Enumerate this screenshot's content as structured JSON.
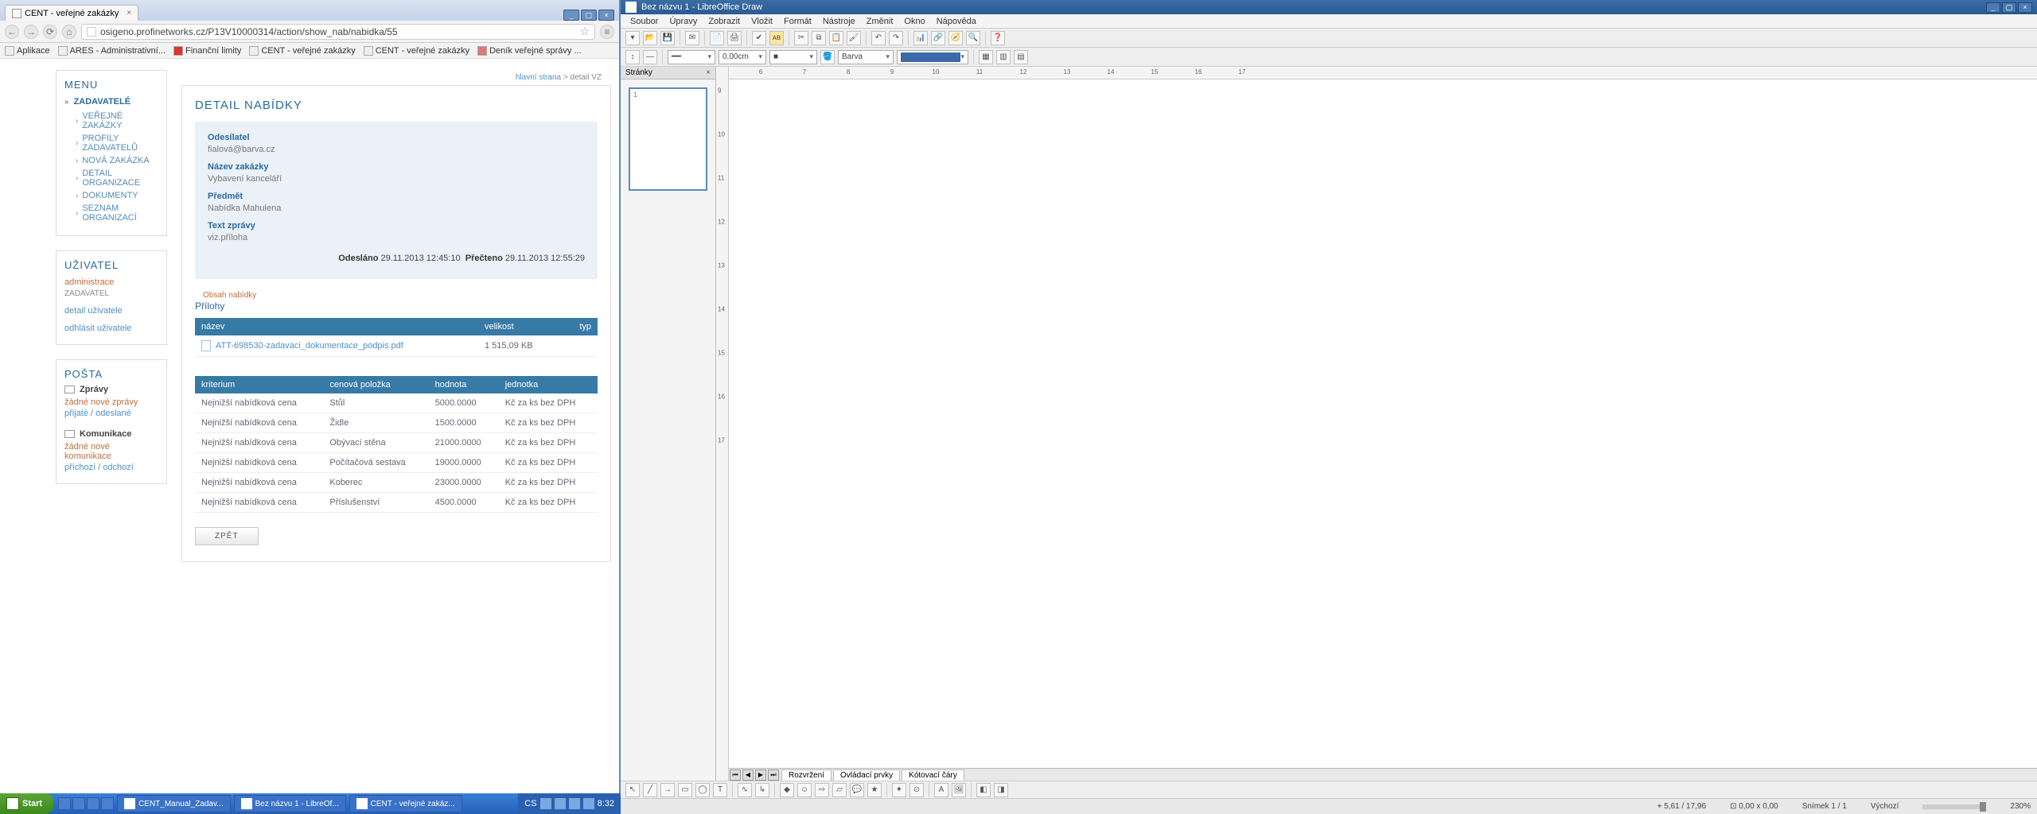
{
  "browser": {
    "tab_title": "CENT - veřejné zakázky",
    "url": "osigeno.profinetworks.cz/P13V10000314/action/show_nab/nabidka/55",
    "bookmarks": [
      "Aplikace",
      "ARES - Administrativní...",
      "Finanční limity",
      "CENT - veřejné zakázky",
      "CENT - veřejné zakázky",
      "Deník veřejné správy ..."
    ]
  },
  "sidebar_menu": {
    "title": "MENU",
    "top": "ZADAVATELÉ",
    "items": [
      "VEŘEJNÉ ZAKÁZKY",
      "PROFILY ZADAVATELŮ",
      "NOVÁ ZAKÁZKA",
      "DETAIL ORGANIZACE",
      "DOKUMENTY",
      "SEZNAM ORGANIZACÍ"
    ]
  },
  "sidebar_user": {
    "title": "UŽIVATEL",
    "name": "administrace",
    "role": "ZADAVATEL",
    "link1": "detail uživatele",
    "link2": "odhlásit uživatele"
  },
  "sidebar_post": {
    "title": "POŠTA",
    "row1": "Zprávy",
    "note1": "žádné nové zprávy",
    "links1": "přijaté / odeslané",
    "row2": "Komunikace",
    "note2": "žádné nové komunikace",
    "links2": "příchozí / odchozí"
  },
  "breadcrumb": {
    "a": "hlavní strana",
    "b": "detail VZ"
  },
  "detail": {
    "heading": "DETAIL NABÍDKY",
    "labels": {
      "odesilatel": "Odesílatel",
      "nazev": "Název zakázky",
      "predmet": "Předmět",
      "text": "Text zprávy"
    },
    "odesilatel": "fialová@barva.cz",
    "nazev": "Vybavení kanceláří",
    "predmet": "Nabídka Mahulena",
    "text": "viz.příloha",
    "sent_label": "Odesláno",
    "sent": "29.11.2013 12:45:10",
    "read_label": "Přečteno",
    "read": "29.11.2013 12:55:29",
    "tab": "Obsah nabídky",
    "section": "Přílohy"
  },
  "files": {
    "head": {
      "name": "název",
      "size": "velikost",
      "type": "typ"
    },
    "row": {
      "name": "ATT-698530-zadavaci_dokumentace_podpis.pdf",
      "size": "1 515,09 KB",
      "type": ""
    }
  },
  "criteria": {
    "head": {
      "k": "kriterium",
      "c": "cenová položka",
      "h": "hodnota",
      "j": "jednotka"
    },
    "rows": [
      {
        "k": "Nejnižší nabídková cena",
        "c": "Stůl",
        "h": "5000.0000",
        "j": "Kč za ks bez DPH"
      },
      {
        "k": "Nejnižší nabídková cena",
        "c": "Židle",
        "h": "1500.0000",
        "j": "Kč za ks bez DPH"
      },
      {
        "k": "Nejnižší nabídková cena",
        "c": "Obývací stěna",
        "h": "21000.0000",
        "j": "Kč za ks bez DPH"
      },
      {
        "k": "Nejnižší nabídková cena",
        "c": "Počítačová sestava",
        "h": "19000.0000",
        "j": "Kč za ks bez DPH"
      },
      {
        "k": "Nejnižší nabídková cena",
        "c": "Koberec",
        "h": "23000.0000",
        "j": "Kč za ks bez DPH"
      },
      {
        "k": "Nejnižší nabídková cena",
        "c": "Příslušenství",
        "h": "4500.0000",
        "j": "Kč za ks bez DPH"
      }
    ]
  },
  "back": "ZPĚT",
  "taskbar": {
    "start": "Start",
    "buttons": [
      "CENT_Manual_Zadav...",
      "Bez názvu 1 - LibreOf...",
      "CENT - veřejné zakáz..."
    ],
    "lang": "CS",
    "time": "8:32"
  },
  "lo": {
    "title": "Bez názvu 1 - LibreOffice Draw",
    "menu": [
      "Soubor",
      "Úpravy",
      "Zobrazit",
      "Vložit",
      "Formát",
      "Nástroje",
      "Změnit",
      "Okno",
      "Nápověda"
    ],
    "combo_width": "0,00cm",
    "combo_color": "Barva",
    "panel": "Stránky",
    "page_num": "1",
    "ruler_h": [
      "6",
      "7",
      "8",
      "9",
      "10",
      "11",
      "12",
      "13",
      "14",
      "15",
      "16",
      "17"
    ],
    "ruler_v": [
      "9",
      "10",
      "11",
      "12",
      "13",
      "14",
      "15",
      "16",
      "17"
    ],
    "tabs": [
      "Rozvržení",
      "Ovládací prvky",
      "Kótovací čáry"
    ],
    "status": {
      "coords": "⌖ 5,61 / 17,96",
      "size": "⊡ 0,00 x 0,00",
      "slide": "Snímek 1 / 1",
      "layer": "Výchozí",
      "zoom": "230%"
    }
  }
}
